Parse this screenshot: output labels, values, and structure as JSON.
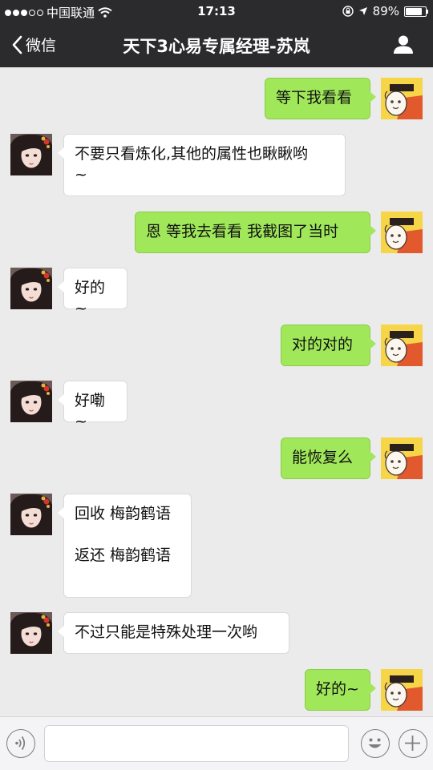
{
  "status_bar": {
    "carrier": "中国联通",
    "time": "17:13",
    "battery": "89%",
    "battery_level": 0.89
  },
  "nav": {
    "back_label": "微信",
    "title": "天下3心易专属经理-苏岚"
  },
  "messages": [
    {
      "side": "out",
      "lines": [
        "等下我看看"
      ]
    },
    {
      "side": "in",
      "lines": [
        "不要只看炼化,其他的属性也瞅瞅哟",
        "~"
      ]
    },
    {
      "side": "out",
      "lines": [
        "恩 等我去看看 我截图了当时"
      ]
    },
    {
      "side": "in",
      "lines": [
        "好的~"
      ]
    },
    {
      "side": "out",
      "lines": [
        "对的对的"
      ]
    },
    {
      "side": "in",
      "lines": [
        "好嘞~"
      ]
    },
    {
      "side": "out",
      "lines": [
        "能恢复么"
      ]
    },
    {
      "side": "in",
      "lines": [
        "回收 梅韵鹤语",
        "",
        "返还 梅韵鹤语"
      ]
    },
    {
      "side": "in",
      "lines": [
        "不过只能是特殊处理一次哟"
      ]
    },
    {
      "side": "out",
      "lines": [
        "好的~"
      ]
    }
  ],
  "icons": {
    "voice": "voice-icon",
    "emoji": "emoji-icon",
    "plus": "plus-icon",
    "profile": "profile-icon",
    "back": "back-chevron-icon"
  },
  "colors": {
    "bar": "#2b2b2d",
    "out_bubble": "#a0e75a",
    "in_bubble": "#ffffff",
    "background": "#ebebeb"
  }
}
